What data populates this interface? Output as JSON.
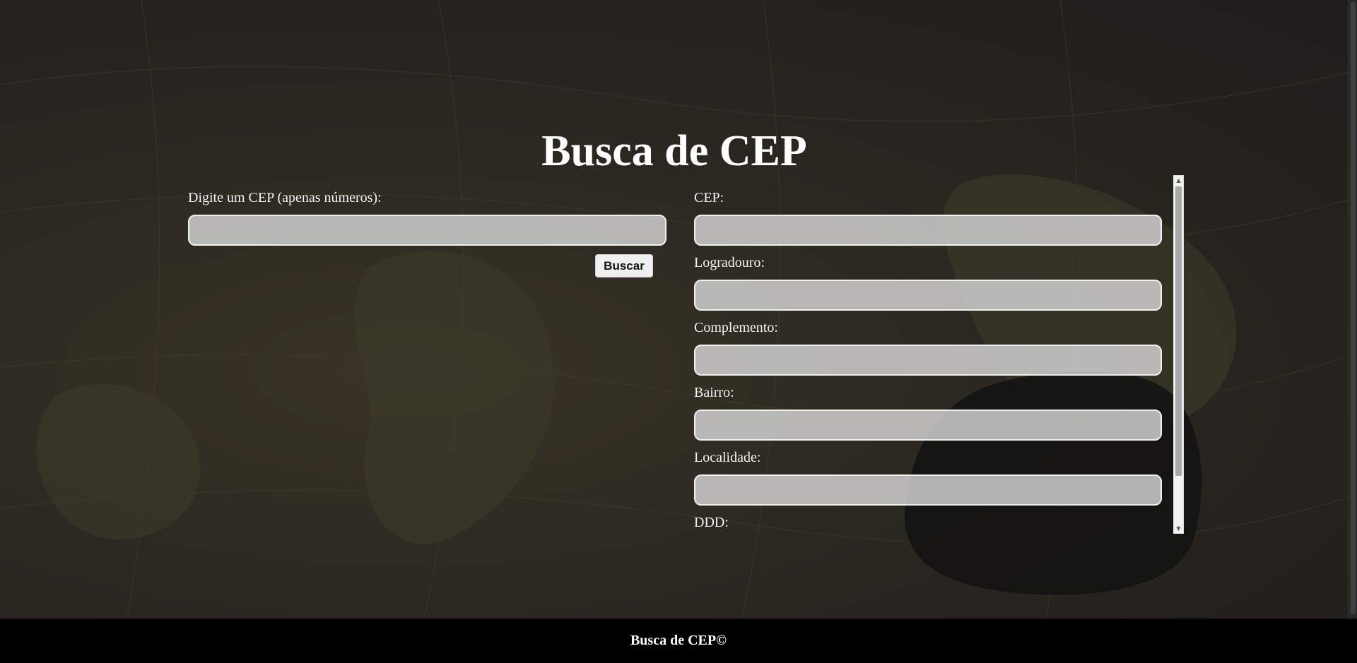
{
  "page": {
    "title": "Busca de CEP"
  },
  "search": {
    "label": "Digite um CEP (apenas números):",
    "value": "",
    "placeholder": "",
    "button_label": "Buscar"
  },
  "results": {
    "fields": [
      {
        "label": "CEP:",
        "value": ""
      },
      {
        "label": "Logradouro:",
        "value": ""
      },
      {
        "label": "Complemento:",
        "value": ""
      },
      {
        "label": "Bairro:",
        "value": ""
      },
      {
        "label": "Localidade:",
        "value": ""
      },
      {
        "label": "DDD:",
        "value": ""
      }
    ]
  },
  "footer": {
    "text": "Busca de CEP©"
  },
  "colors": {
    "background": "#2b2721",
    "field_bg": "#d7d7d7",
    "field_border": "#f0f0f0",
    "footer_bg": "#000000",
    "text": "#ffffff"
  },
  "icons": {
    "scroll_up": "scroll-up-arrow-icon",
    "scroll_down": "scroll-down-arrow-icon"
  }
}
